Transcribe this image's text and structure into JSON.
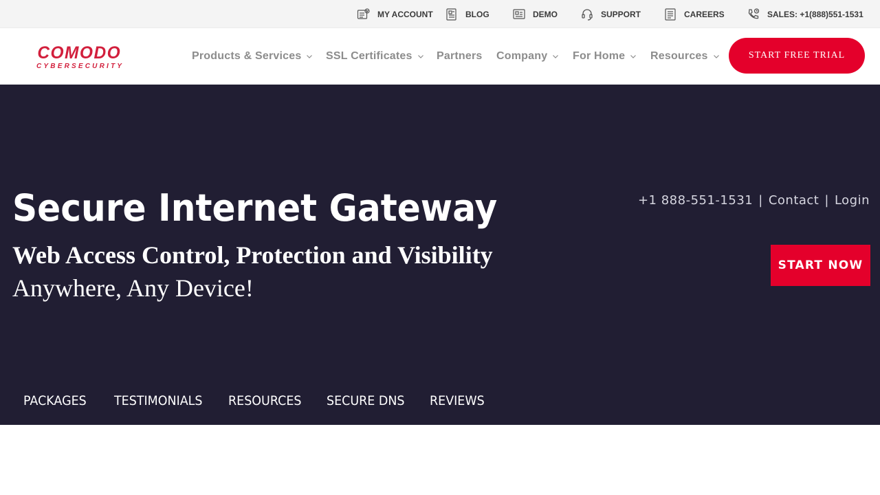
{
  "topbar": {
    "links": [
      {
        "label": "MY ACCOUNT",
        "icon": "account-icon"
      },
      {
        "label": "BLOG",
        "icon": "blog-icon"
      },
      {
        "label": "DEMO",
        "icon": "demo-icon"
      },
      {
        "label": "SUPPORT",
        "icon": "headset-icon"
      },
      {
        "label": "CAREERS",
        "icon": "careers-icon"
      },
      {
        "label": "SALES: +1(888)551-1531",
        "icon": "phone-icon"
      }
    ]
  },
  "header": {
    "logo": {
      "main": "COMODO",
      "sub": "CYBERSECURITY"
    },
    "nav": [
      {
        "label": "Products & Services",
        "dropdown": true
      },
      {
        "label": "SSL Certificates",
        "dropdown": true
      },
      {
        "label": "Partners",
        "dropdown": false
      },
      {
        "label": "Company",
        "dropdown": true
      },
      {
        "label": "For Home",
        "dropdown": true
      },
      {
        "label": "Resources",
        "dropdown": true
      }
    ],
    "cta_label": "START FREE TRIAL"
  },
  "hero": {
    "title": "Secure Internet Gateway",
    "subtitle": "Web Access Control, Protection and Visibility",
    "subtitle2": "Anywhere, Any Device!",
    "contact": {
      "phone": "+1 888-551-1531",
      "separator": "|",
      "contact_label": "Contact",
      "login_label": "Login"
    },
    "start_label": "START NOW",
    "tabs": [
      {
        "label": "PACKAGES"
      },
      {
        "label": "TESTIMONIALS"
      },
      {
        "label": "RESOURCES"
      },
      {
        "label": "SECURE DNS"
      },
      {
        "label": "REVIEWS"
      }
    ]
  },
  "colors": {
    "brand_red": "#e4002b",
    "hero_bg": "#211e33",
    "topbar_bg": "#f4f4f4",
    "nav_text": "#8c8c8c"
  }
}
